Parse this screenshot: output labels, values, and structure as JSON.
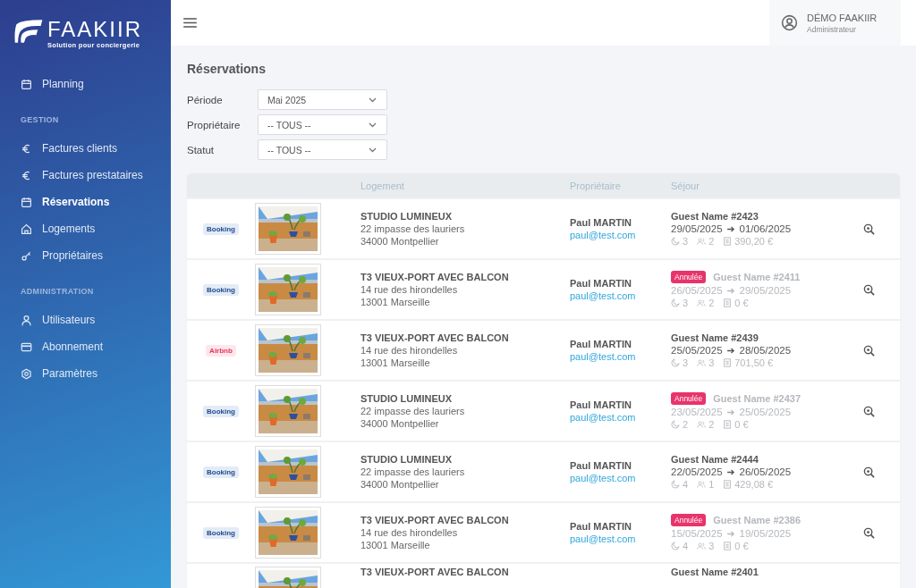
{
  "brand": {
    "name": "FAAKIIR",
    "tagline": "Solution pour conciergerie"
  },
  "sidebar": {
    "sections": [
      {
        "items": [
          {
            "label": "Planning",
            "kind": "calendar",
            "selected": false
          }
        ]
      },
      {
        "heading": "GESTION",
        "items": [
          {
            "label": "Factures clients",
            "kind": "euro",
            "selected": false
          },
          {
            "label": "Factures prestataires",
            "kind": "euro",
            "selected": false
          },
          {
            "label": "Réservations",
            "kind": "calendar",
            "selected": true
          },
          {
            "label": "Logements",
            "kind": "home",
            "selected": false
          },
          {
            "label": "Propriétaires",
            "kind": "key",
            "selected": false
          }
        ]
      },
      {
        "heading": "ADMINISTRATION",
        "items": [
          {
            "label": "Utilisateurs",
            "kind": "user",
            "selected": false
          },
          {
            "label": "Abonnement",
            "kind": "card",
            "selected": false
          },
          {
            "label": "Paramètres",
            "kind": "gear",
            "selected": false
          }
        ]
      }
    ]
  },
  "user": {
    "name": "DÉMO FAAKIIR",
    "role": "Administrateur"
  },
  "page_title": "Réservations",
  "filters": [
    {
      "label": "Période",
      "value": "Mai 2025"
    },
    {
      "label": "Propriétaire",
      "value": "-- TOUS --"
    },
    {
      "label": "Statut",
      "value": "-- TOUS --"
    }
  ],
  "table": {
    "columns": [
      "",
      "",
      "Logement",
      "Propriétaire",
      "Séjour",
      ""
    ],
    "rows": [
      {
        "channel": "Booking",
        "kind": "booking",
        "title": "STUDIO LUMINEUX",
        "address": "22 impasse des lauriers",
        "city": "34000 Montpellier",
        "owner": "Paul MARTIN",
        "email": "paul@test.com",
        "cancelled": false,
        "guest": "Guest Name #2423",
        "from": "29/05/2025",
        "to": "01/06/2025",
        "nights": "3",
        "guests": "2",
        "amount": "390,20 €"
      },
      {
        "channel": "Booking",
        "kind": "booking",
        "title": "T3 VIEUX-PORT AVEC BALCON",
        "address": "14 rue des hirondelles",
        "city": "13001 Marseille",
        "owner": "Paul MARTIN",
        "email": "paul@test.com",
        "cancelled": true,
        "status_badge": "Annulée",
        "guest": "Guest Name #2411",
        "from": "26/05/2025",
        "to": "29/05/2025",
        "nights": "3",
        "guests": "2",
        "amount": "0 €"
      },
      {
        "channel": "Airbnb",
        "kind": "airbnb",
        "title": "T3 VIEUX-PORT AVEC BALCON",
        "address": "14 rue des hirondelles",
        "city": "13001 Marseille",
        "owner": "Paul MARTIN",
        "email": "paul@test.com",
        "cancelled": false,
        "guest": "Guest Name #2439",
        "from": "25/05/2025",
        "to": "28/05/2025",
        "nights": "3",
        "guests": "3",
        "amount": "701,50 €"
      },
      {
        "channel": "Booking",
        "kind": "booking",
        "title": "STUDIO LUMINEUX",
        "address": "22 impasse des lauriers",
        "city": "34000 Montpellier",
        "owner": "Paul MARTIN",
        "email": "paul@test.com",
        "cancelled": true,
        "status_badge": "Annulée",
        "guest": "Guest Name #2437",
        "from": "23/05/2025",
        "to": "25/05/2025",
        "nights": "2",
        "guests": "2",
        "amount": "0 €"
      },
      {
        "channel": "Booking",
        "kind": "booking",
        "title": "STUDIO LUMINEUX",
        "address": "22 impasse des lauriers",
        "city": "34000 Montpellier",
        "owner": "Paul MARTIN",
        "email": "paul@test.com",
        "cancelled": false,
        "guest": "Guest Name #2444",
        "from": "22/05/2025",
        "to": "26/05/2025",
        "nights": "4",
        "guests": "1",
        "amount": "429,08 €"
      },
      {
        "channel": "Booking",
        "kind": "booking",
        "title": "T3 VIEUX-PORT AVEC BALCON",
        "address": "14 rue des hirondelles",
        "city": "13001 Marseille",
        "owner": "Paul MARTIN",
        "email": "paul@test.com",
        "cancelled": true,
        "status_badge": "Annulée",
        "guest": "Guest Name #2386",
        "from": "15/05/2025",
        "to": "19/05/2025",
        "nights": "4",
        "guests": "3",
        "amount": "0 €"
      },
      {
        "title": "T3 VIEUX-PORT AVEC BALCON",
        "cancelled": false,
        "guest": "Guest Name #2401"
      }
    ]
  }
}
